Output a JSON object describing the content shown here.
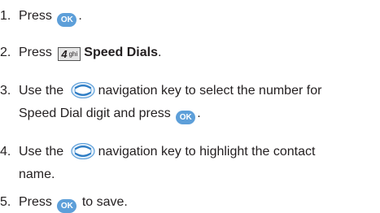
{
  "steps": [
    {
      "num": "1.",
      "before": "Press",
      "after": "."
    },
    {
      "num": "2.",
      "before": "Press",
      "key_digit": "4",
      "key_letters": "ghi",
      "bold": "Speed Dials",
      "after": "."
    },
    {
      "num": "3.",
      "before": "Use the",
      "after": "navigation key to select the number for",
      "line2": "Speed Dial digit and press",
      "line2_after": "."
    },
    {
      "num": "4.",
      "before": "Use the",
      "after": "navigation key to highlight the contact",
      "line2": "name."
    },
    {
      "num": "5.",
      "before": "Press",
      "after": "to save."
    }
  ],
  "ok_label": "OK",
  "icons": {
    "ok_key": "ok-key-icon",
    "nav_key": "navigation-key-icon",
    "number_key": "4-ghi-key-icon"
  },
  "colors": {
    "ok_key": "#5d9fd9",
    "nav_key": "#5d9fd9",
    "text": "#231f20"
  }
}
